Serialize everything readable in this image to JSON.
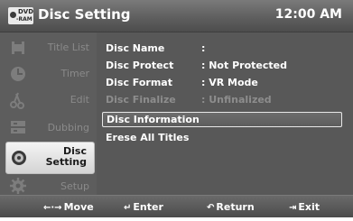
{
  "header": {
    "badge_top": "DVD",
    "badge_bottom": "-RAM",
    "title": "Disc Setting",
    "clock": "12:00 AM"
  },
  "sidebar": {
    "items": [
      {
        "label": "Title List",
        "icon": "title-list-icon"
      },
      {
        "label": "Timer",
        "icon": "clock-icon"
      },
      {
        "label": "Edit",
        "icon": "scissors-icon"
      },
      {
        "label": "Dubbing",
        "icon": "dubbing-icon"
      },
      {
        "label": "Disc Setting",
        "label_line1": "Disc",
        "label_line2": "Setting",
        "icon": "disc-icon",
        "active": true
      },
      {
        "label": "Setup",
        "icon": "gear-icon"
      }
    ]
  },
  "main": {
    "rows": [
      {
        "label": "Disc Name",
        "value": ":"
      },
      {
        "label": "Disc Protect",
        "value": ": Not Protected"
      },
      {
        "label": "Disc Format",
        "value": ": VR Mode"
      },
      {
        "label": "Disc Finalize",
        "value": ": Unfinalized",
        "disabled": true
      },
      {
        "label": "Disc Information",
        "value": "",
        "selected": true
      },
      {
        "label": "Erese All Titles",
        "value": ""
      }
    ]
  },
  "footer": {
    "move": "Move",
    "enter": "Enter",
    "return": "Return",
    "exit": "Exit"
  },
  "colors": {
    "background": "#5b5b5b",
    "header": "#6a6a6a",
    "active_tab": "#e8e8e8",
    "dim_text": "#8d8d8d"
  }
}
